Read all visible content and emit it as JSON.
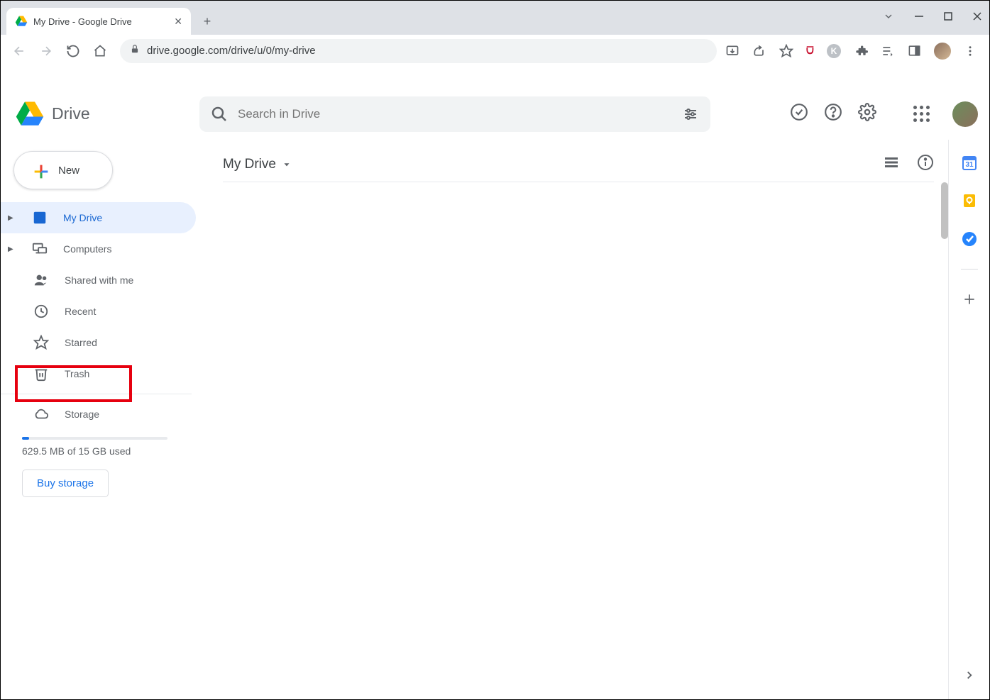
{
  "browser": {
    "tab_title": "My Drive - Google Drive",
    "url": "drive.google.com/drive/u/0/my-drive"
  },
  "header": {
    "logo_text": "Drive",
    "search_placeholder": "Search in Drive"
  },
  "sidebar": {
    "new_label": "New",
    "items": [
      {
        "label": "My Drive"
      },
      {
        "label": "Computers"
      },
      {
        "label": "Shared with me"
      },
      {
        "label": "Recent"
      },
      {
        "label": "Starred"
      },
      {
        "label": "Trash"
      },
      {
        "label": "Storage"
      }
    ],
    "storage_text": "629.5 MB of 15 GB used",
    "buy_label": "Buy storage"
  },
  "content": {
    "breadcrumb": "My Drive"
  },
  "highlight": {
    "target": "Trash"
  }
}
